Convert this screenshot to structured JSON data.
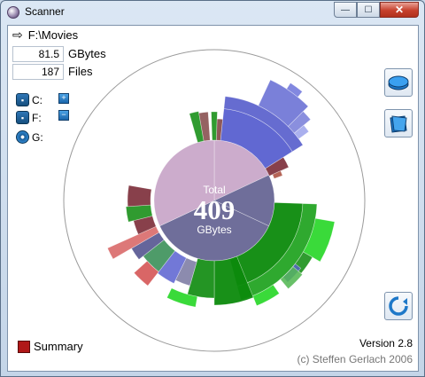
{
  "window": {
    "title": "Scanner"
  },
  "path": "F:\\Movies",
  "stats": {
    "size_value": "81.5",
    "size_unit": "GBytes",
    "files_value": "187",
    "files_unit": "Files"
  },
  "drives": [
    {
      "label": "C:"
    },
    {
      "label": "F:"
    },
    {
      "label": "G:"
    }
  ],
  "center": {
    "top": "Total",
    "value": "409",
    "unit": "GBytes"
  },
  "summary_label": "Summary",
  "version": "Version 2.8",
  "copyright": "(c) Steffen Gerlach 2006",
  "colors": {
    "slate": "#6f6e9a",
    "pink": "#ccaccc",
    "green": "#0c8a0c",
    "bright_green": "#18d418",
    "blue": "#5960d0",
    "maroon": "#7b2b37",
    "red": "#d24b4b"
  }
}
